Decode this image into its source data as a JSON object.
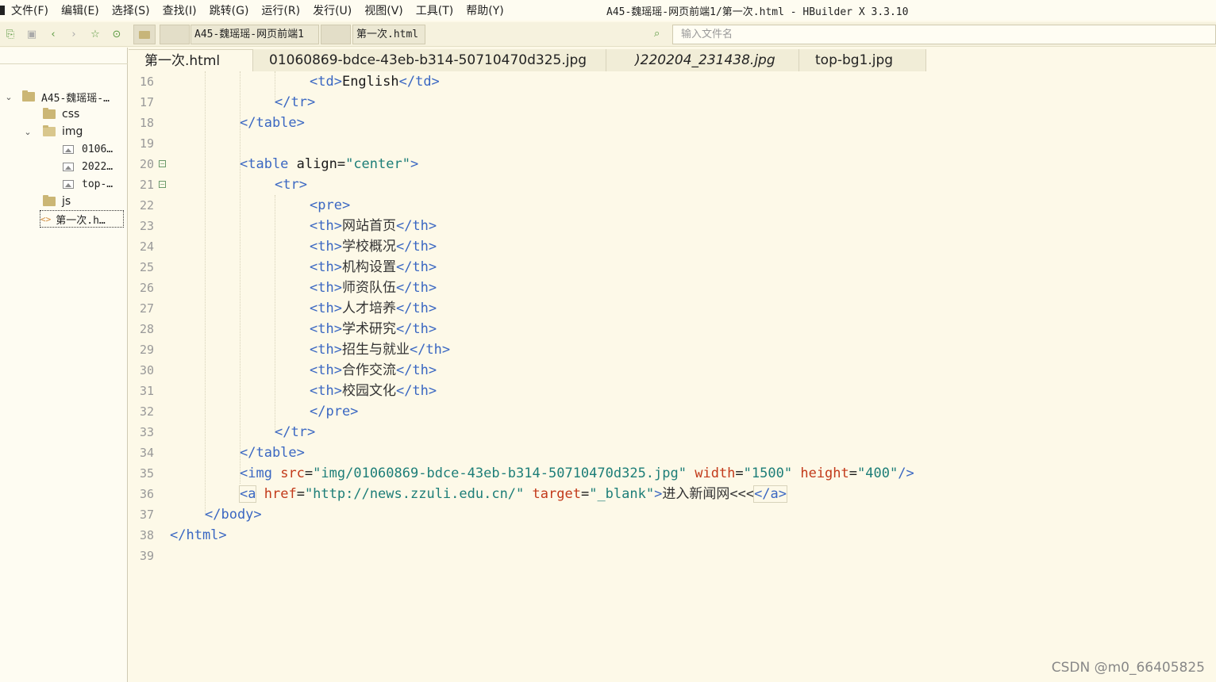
{
  "menubar": {
    "items": [
      "文件(F)",
      "编辑(E)",
      "选择(S)",
      "查找(I)",
      "跳转(G)",
      "运行(R)",
      "发行(U)",
      "视图(V)",
      "工具(T)",
      "帮助(Y)"
    ],
    "title": "A45-魏瑶瑶-网页前端1/第一次.html - HBuilder X 3.3.10"
  },
  "toolbar": {
    "icons": [
      "new-file-icon",
      "save-icon",
      "back-icon",
      "forward-icon",
      "star-icon",
      "run-icon"
    ],
    "crumb_project": "A45-魏瑶瑶-网页前端1",
    "crumb_file": "第一次.html",
    "search_placeholder": "输入文件名"
  },
  "sidebar": {
    "project": "A45-魏瑶瑶-…",
    "css": "css",
    "img": "img",
    "img_files": [
      "0106…",
      "2022…",
      "top-…"
    ],
    "js": "js",
    "file": "第一次.h…"
  },
  "tabs": [
    "第一次.html",
    "01060869-bdce-43eb-b314-50710470d325.jpg",
    ")220204_231438.jpg",
    "top-bg1.jpg"
  ],
  "editor": {
    "line_numbers": [
      "16",
      "17",
      "18",
      "19",
      "20",
      "21",
      "22",
      "23",
      "24",
      "25",
      "26",
      "27",
      "28",
      "29",
      "30",
      "31",
      "32",
      "33",
      "34",
      "35",
      "36",
      "37",
      "38",
      "39"
    ],
    "td_text": "English",
    "th_items": [
      "网站首页",
      "学校概况",
      "机构设置",
      "师资队伍",
      "人才培养",
      "学术研究",
      "招生与就业",
      "合作交流",
      "校园文化"
    ],
    "align_value": "\"center\"",
    "img_src": "\"img/01060869-bdce-43eb-b314-50710470d325.jpg\"",
    "img_width": "\"1500\"",
    "img_height": "\"400\"",
    "a_href": "\"http://news.zzuli.edu.cn/\"",
    "a_target": "\"_blank\"",
    "a_text": "进入新闻网<<<"
  },
  "watermark": "CSDN @m0_66405825"
}
